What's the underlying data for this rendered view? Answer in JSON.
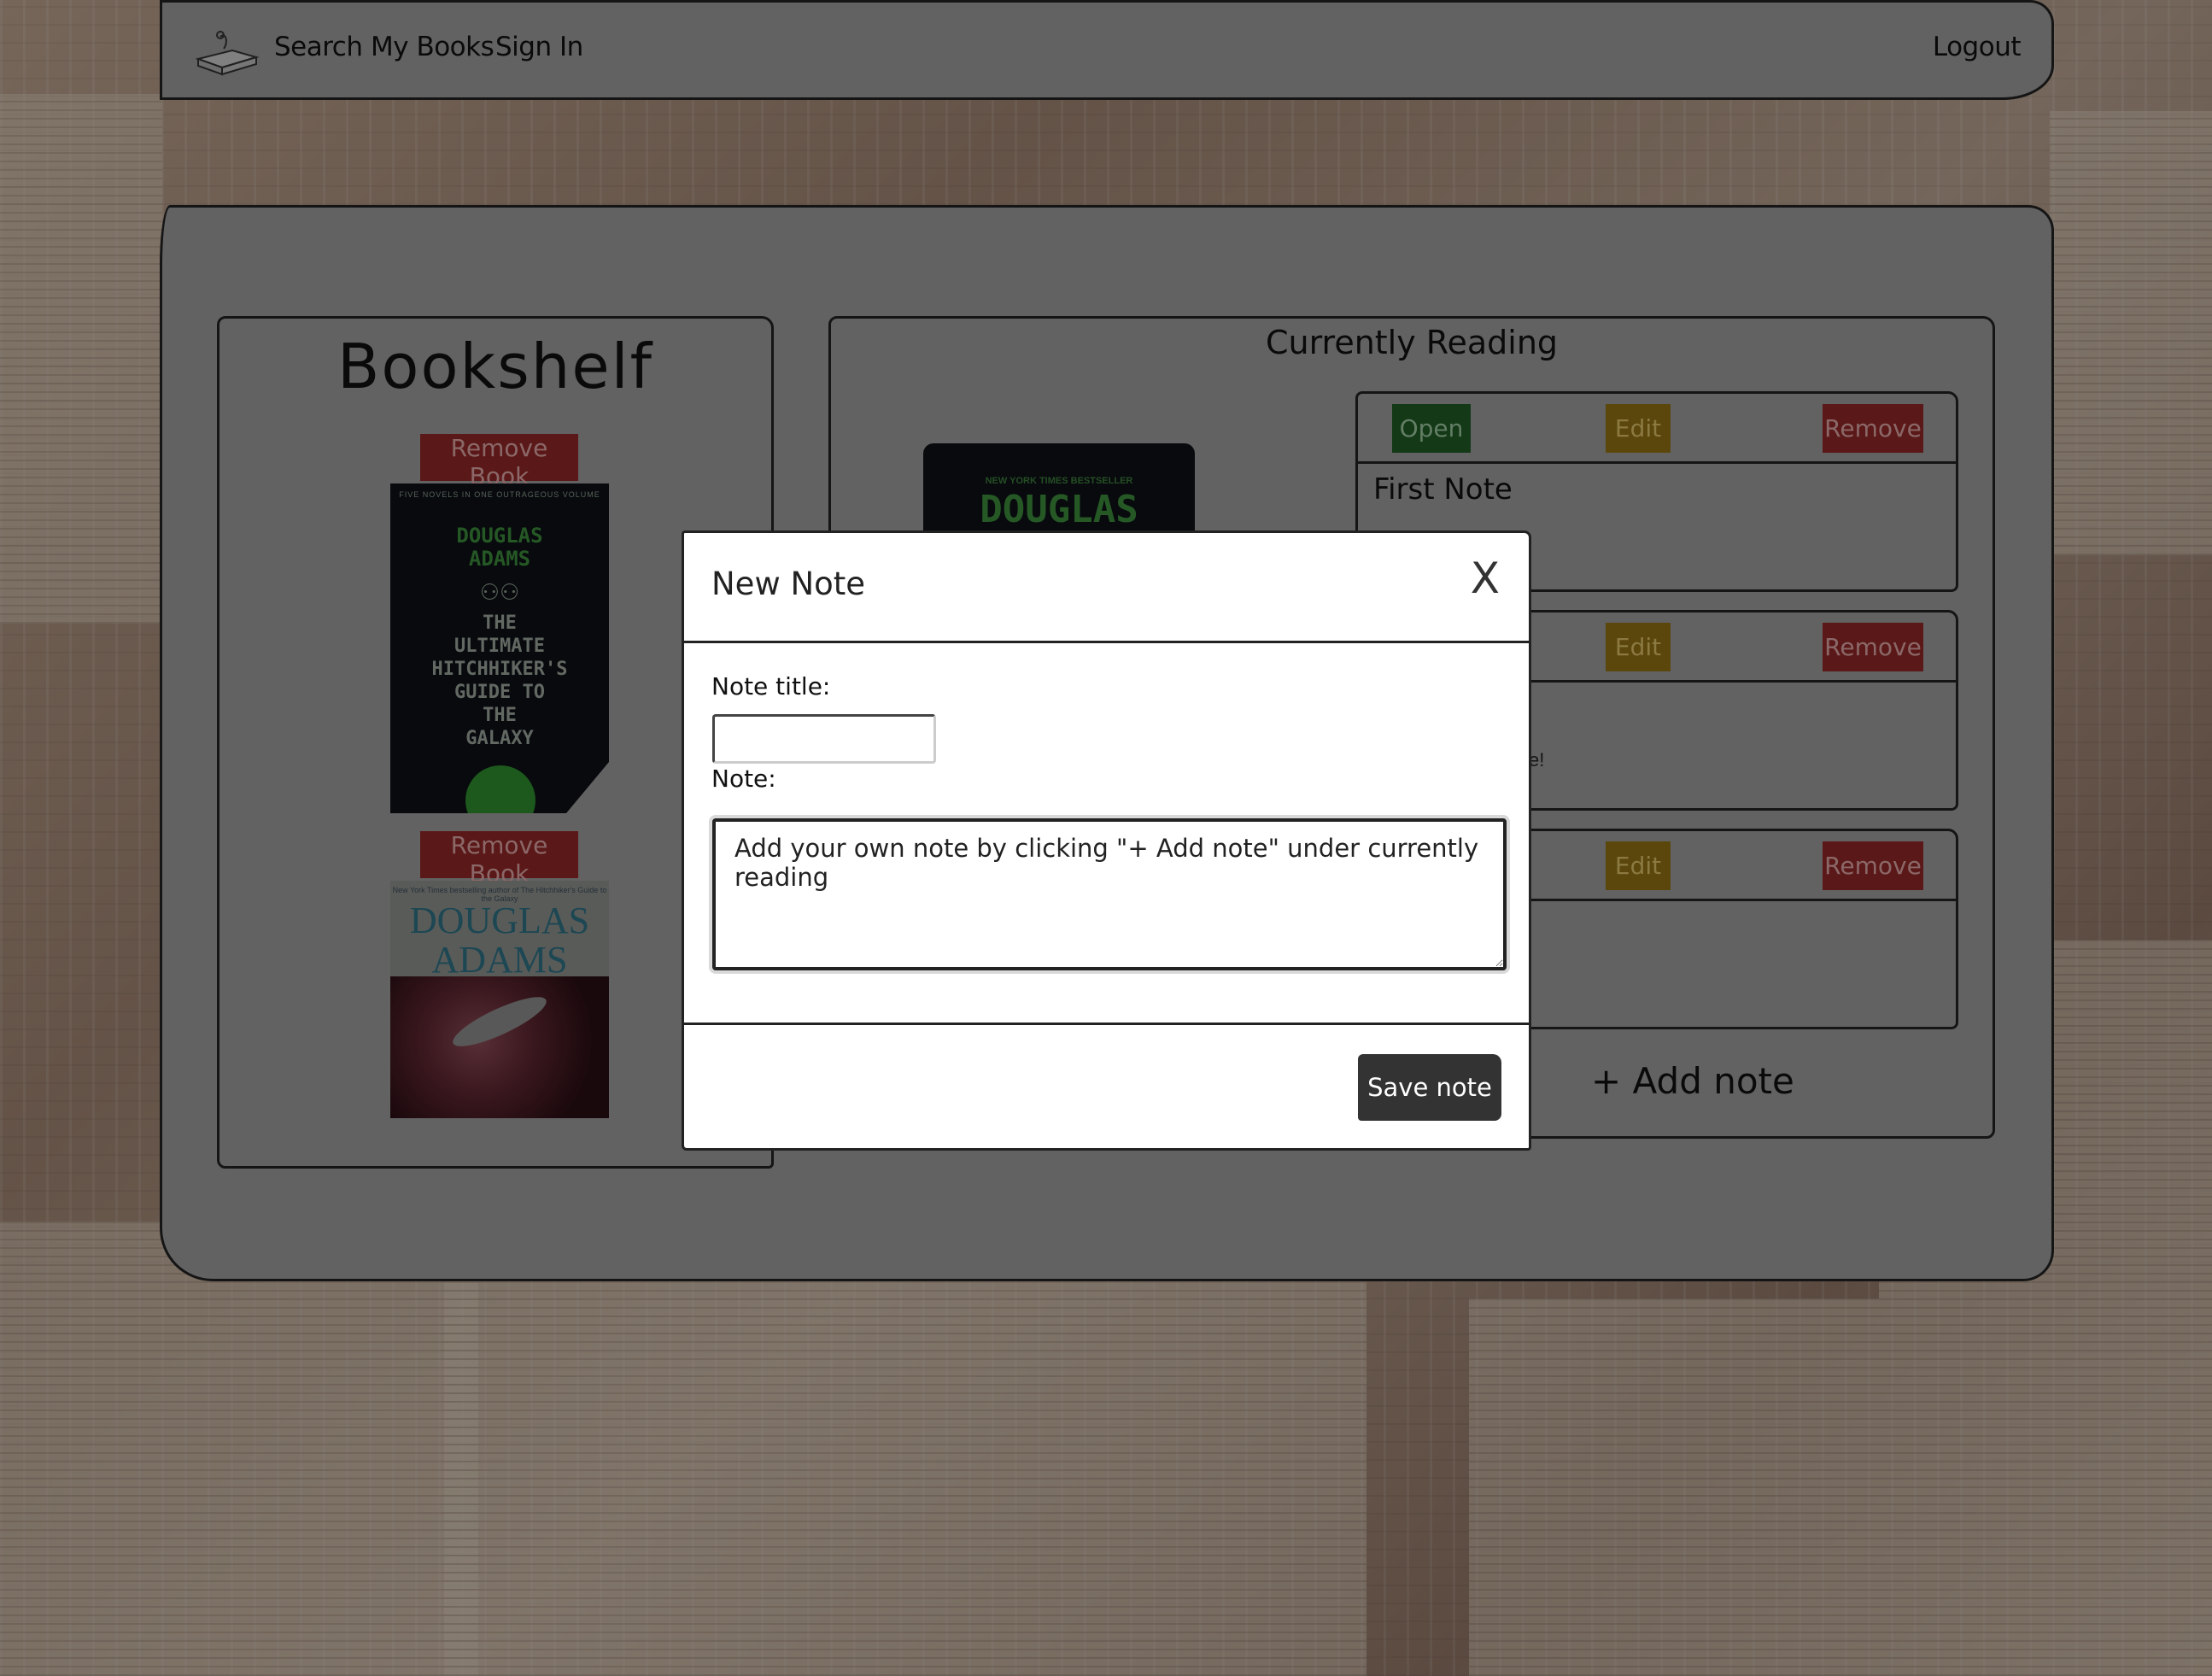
{
  "nav": {
    "logo_icon": "book-stack-icon",
    "search": "Search",
    "my_books": "My Books",
    "sign_in": "Sign In",
    "logout": "Logout"
  },
  "bookshelf": {
    "title": "Bookshelf",
    "books": [
      {
        "remove_label": "Remove Book",
        "cover": {
          "top_text": "FIVE NOVELS IN ONE OUTRAGEOUS VOLUME",
          "author_lines": [
            "DOUGLAS",
            "ADAMS"
          ],
          "title_lines": [
            "THE",
            "ULTIMATE",
            "HITCHHIKER'S",
            "GUIDE TO",
            "THE",
            "GALAXY"
          ]
        }
      },
      {
        "remove_label": "Remove Book",
        "cover": {
          "top_text": "New York Times bestselling author of The Hitchhiker's Guide to the Galaxy",
          "author_lines": [
            "DOUGLAS",
            "ADAMS"
          ]
        }
      }
    ]
  },
  "reading": {
    "title": "Currently Reading",
    "cover": {
      "top_text": "NEW YORK TIMES BESTSELLER",
      "author": "DOUGLAS"
    },
    "notes": [
      {
        "open": "Open",
        "edit": "Edit",
        "remove": "Remove",
        "title": "First Note",
        "body_fragment": ""
      },
      {
        "open": "",
        "edit": "Edit",
        "remove": "Remove",
        "title": "",
        "body_fragment": "e!"
      },
      {
        "open": "",
        "edit": "Edit",
        "remove": "Remove",
        "title": "",
        "body_fragment": ""
      }
    ],
    "add_note": "+ Add note"
  },
  "modal": {
    "title": "New Note",
    "close": "X",
    "title_label": "Note title:",
    "title_value": "",
    "note_label": "Note:",
    "note_value": "Add your own note by clicking \"+ Add note\" under currently reading",
    "save": "Save note"
  },
  "colors": {
    "open_button": "#2a7a31",
    "edit_button": "#c59a1b",
    "remove_button": "#c43535",
    "save_button": "#333333"
  }
}
